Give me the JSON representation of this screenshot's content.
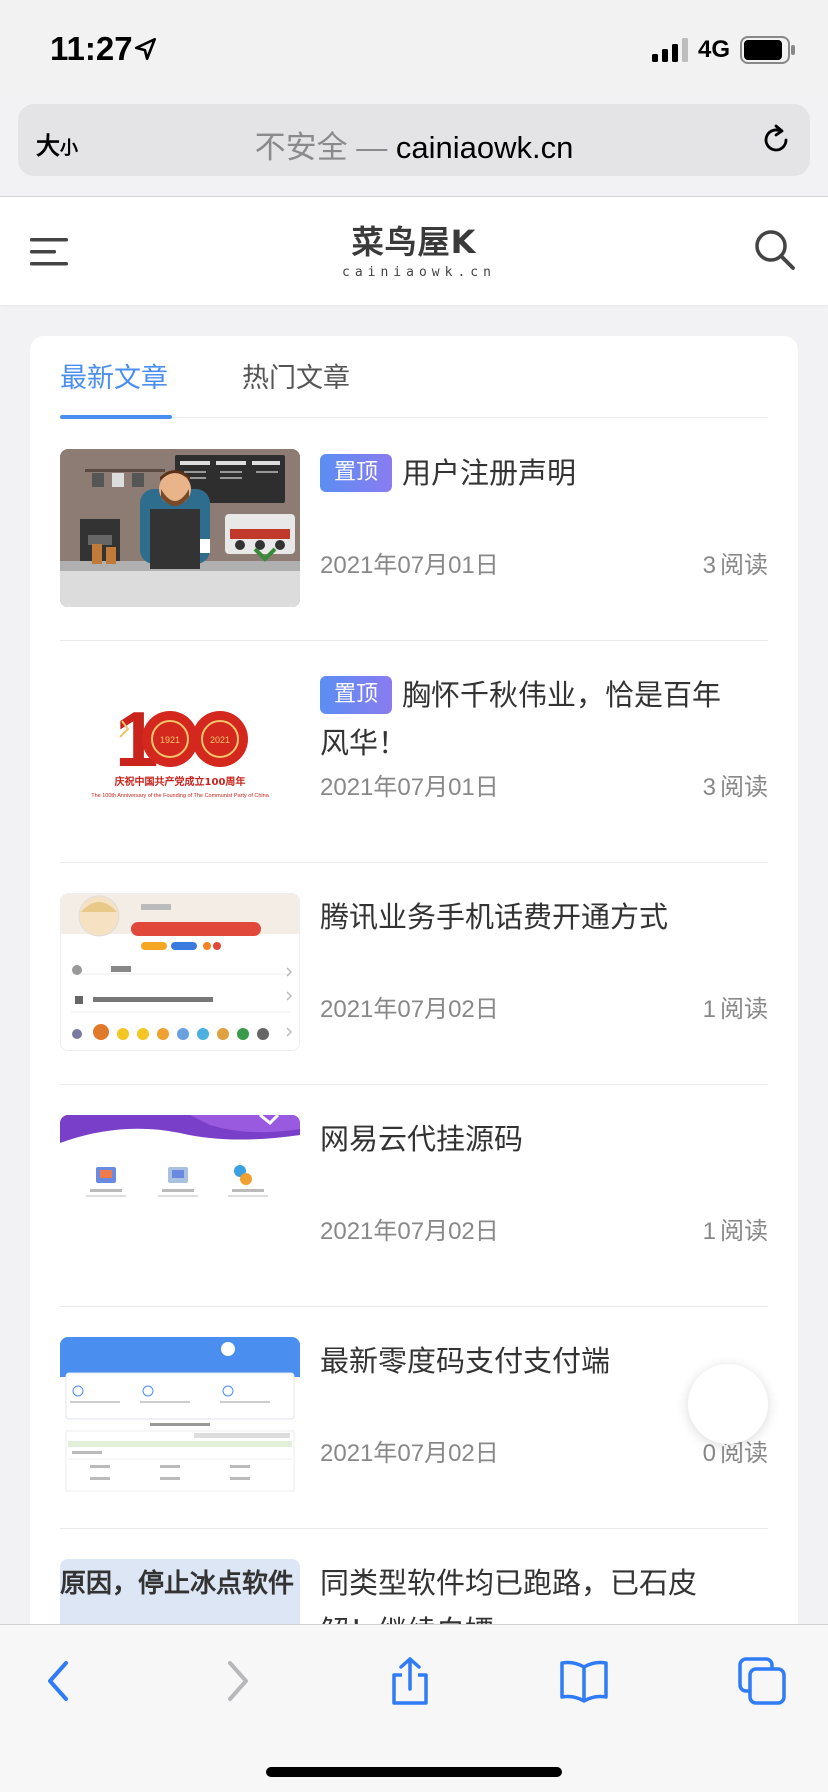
{
  "status_bar": {
    "time": "11:27",
    "network": "4G"
  },
  "browser": {
    "reader_label": "大",
    "reader_label_small": "小",
    "url_insecure": "不安全 — ",
    "url_domain": "cainiaowk.cn"
  },
  "site": {
    "logo_text": "菜鸟屋K",
    "logo_sub": "cainiaowk.cn"
  },
  "tabs": [
    {
      "label": "最新文章",
      "active": true
    },
    {
      "label": "热门文章",
      "active": false
    }
  ],
  "articles": [
    {
      "badge": "置顶",
      "title": "用户注册声明",
      "date": "2021年07月01日",
      "reads": "3",
      "reads_label": "阅读"
    },
    {
      "badge": "置顶",
      "title": "胸怀千秋伟业，恰是百年风华！",
      "date": "2021年07月01日",
      "reads": "3",
      "reads_label": "阅读",
      "thumb_text": "庆祝中国共产党成立100周年",
      "thumb_text_en": "The 100th Anniversary of the Founding of The Communist Party of China"
    },
    {
      "badge": "",
      "title": "腾讯业务手机话费开通方式",
      "date": "2021年07月02日",
      "reads": "1",
      "reads_label": "阅读"
    },
    {
      "badge": "",
      "title": "网易云代挂源码",
      "date": "2021年07月02日",
      "reads": "1",
      "reads_label": "阅读"
    },
    {
      "badge": "",
      "title": "最新零度码支付支付端",
      "date": "2021年07月02日",
      "reads": "0",
      "reads_label": "阅读"
    },
    {
      "badge": "",
      "title": "同类型软件均已跑路，已石皮解！继续白嫖",
      "date": "",
      "reads": "",
      "reads_label": "",
      "thumb_text": "原因，停止冰点软件"
    }
  ],
  "colors": {
    "accent": "#4a8ff0",
    "badge_start": "#5b8ef2",
    "badge_end": "#8a7cf0",
    "ios_blue": "#2f7cf6"
  }
}
